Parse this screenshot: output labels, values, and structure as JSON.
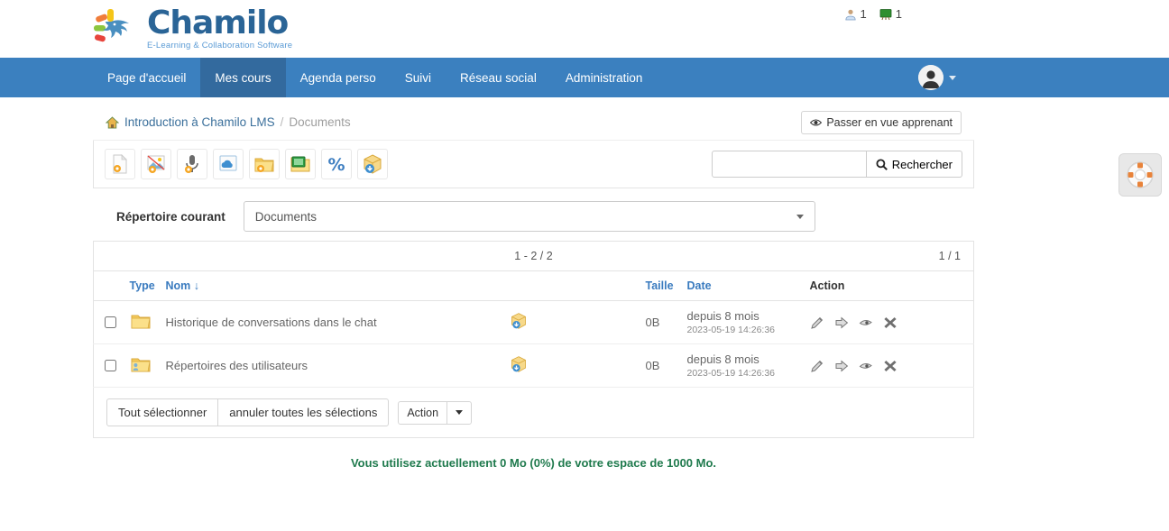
{
  "brand": {
    "name": "Chamilo",
    "tagline": "E-Learning & Collaboration Software"
  },
  "topstats": [
    {
      "icon": "user-icon",
      "name": "users-online-count",
      "value": "1"
    },
    {
      "icon": "course-icon",
      "name": "courses-count",
      "value": "1"
    }
  ],
  "nav": {
    "items": [
      {
        "label": "Page d'accueil",
        "name": "nav-item-home",
        "active": false
      },
      {
        "label": "Mes cours",
        "name": "nav-item-my-courses",
        "active": true
      },
      {
        "label": "Agenda perso",
        "name": "nav-item-agenda",
        "active": false
      },
      {
        "label": "Suivi",
        "name": "nav-item-reporting",
        "active": false
      },
      {
        "label": "Réseau social",
        "name": "nav-item-social",
        "active": false
      },
      {
        "label": "Administration",
        "name": "nav-item-administration",
        "active": false
      }
    ]
  },
  "breadcrumb": {
    "home_icon": "home-icon",
    "course": "Introduction à Chamilo LMS",
    "separator": "/",
    "current": "Documents"
  },
  "student_view_button": {
    "label": "Passer en vue apprenant",
    "icon": "eye-icon"
  },
  "toolbar": {
    "tools": [
      {
        "name": "create-document-button",
        "icon": "document-gear-icon"
      },
      {
        "name": "create-drawing-button",
        "icon": "image-gear-icon"
      },
      {
        "name": "record-audio-button",
        "icon": "microphone-gear-icon"
      },
      {
        "name": "cloud-link-button",
        "icon": "cloud-link-icon"
      },
      {
        "name": "create-folder-button",
        "icon": "folder-gear-icon"
      },
      {
        "name": "record-video-button",
        "icon": "webcam-icon"
      },
      {
        "name": "templates-button",
        "icon": "percent-icon"
      },
      {
        "name": "upload-document-button",
        "icon": "package-download-icon"
      }
    ],
    "search": {
      "value": "",
      "placeholder": "",
      "button_label": "Rechercher",
      "button_icon": "search-icon"
    }
  },
  "directory": {
    "label": "Répertoire courant",
    "selected": "Documents"
  },
  "pagination": {
    "range": "1 - 2 / 2",
    "pages": "1 / 1"
  },
  "table": {
    "columns": [
      {
        "label": "Type",
        "name": "column-type",
        "link": true
      },
      {
        "label": "Nom ↓",
        "name": "column-name",
        "link": true
      },
      {
        "label": "Taille",
        "name": "column-size",
        "link": true
      },
      {
        "label": "Date",
        "name": "column-date",
        "link": true
      },
      {
        "label": "Action",
        "name": "column-action",
        "link": false
      }
    ],
    "rows": [
      {
        "name": "Historique de conversations dans le chat",
        "type_icon": "folder-icon",
        "download_icon": "package-download-icon",
        "size": "0B",
        "date_relative": "depuis 8 mois",
        "date_exact": "2023-05-19 14:26:36",
        "actions": [
          "edit-icon",
          "move-icon",
          "visibility-icon",
          "delete-icon"
        ]
      },
      {
        "name": "Répertoires des utilisateurs",
        "type_icon": "folder-users-icon",
        "download_icon": "package-download-icon",
        "size": "0B",
        "date_relative": "depuis 8 mois",
        "date_exact": "2023-05-19 14:26:36",
        "actions": [
          "edit-icon",
          "move-icon",
          "visibility-icon",
          "delete-icon"
        ]
      }
    ]
  },
  "bulk": {
    "select_all": "Tout sélectionner",
    "unselect_all": "annuler toutes les sélections",
    "action_label": "Action"
  },
  "quota": "Vous utilisez actuellement 0 Mo (0%) de votre espace de 1000 Mo.",
  "help": {
    "name": "help-button",
    "icon": "lifering-icon"
  },
  "colors": {
    "nav_blue": "#3b80bf",
    "nav_active": "#336a9e",
    "link_blue": "#3a7bbf",
    "quota_green": "#1f7a4d"
  }
}
